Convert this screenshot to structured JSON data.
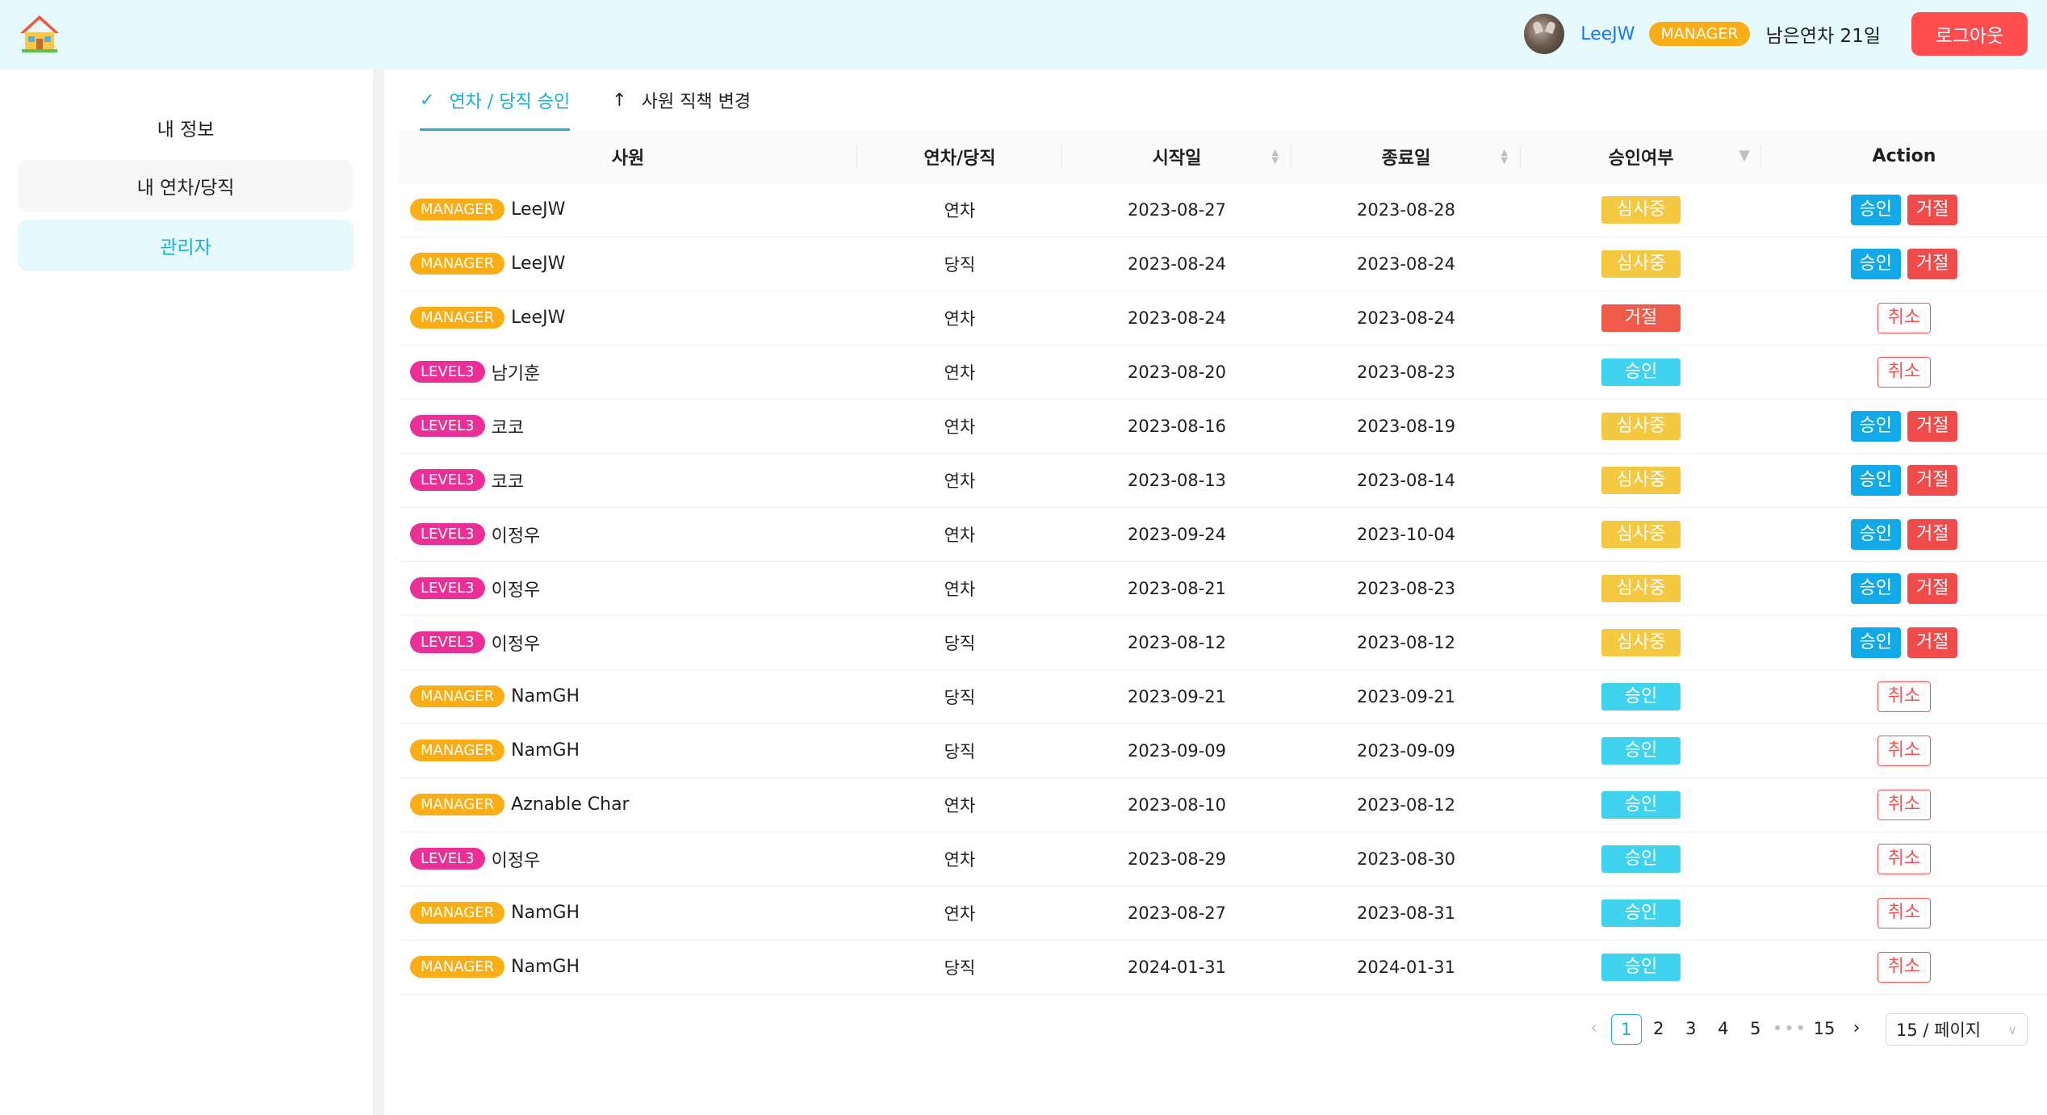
{
  "header": {
    "user_name": "LeeJW",
    "role": "MANAGER",
    "remaining_leave": "남은연차 21일",
    "logout_label": "로그아웃"
  },
  "sidebar": {
    "items": [
      {
        "label": "내 정보"
      },
      {
        "label": "내 연차/당직"
      },
      {
        "label": "관리자"
      }
    ]
  },
  "tabs": [
    {
      "label": "연차 / 당직 승인",
      "icon": "check-icon"
    },
    {
      "label": "사원 직책 변경",
      "icon": "arrow-up-icon"
    }
  ],
  "table": {
    "columns": [
      "사원",
      "연차/당직",
      "시작일",
      "종료일",
      "승인여부",
      "Action"
    ],
    "rows": [
      {
        "role": "MANAGER",
        "name": "LeeJW",
        "type": "연차",
        "start": "2023-08-27",
        "end": "2023-08-28",
        "status": "심사중",
        "actions": [
          "승인",
          "거절"
        ]
      },
      {
        "role": "MANAGER",
        "name": "LeeJW",
        "type": "당직",
        "start": "2023-08-24",
        "end": "2023-08-24",
        "status": "심사중",
        "actions": [
          "승인",
          "거절"
        ]
      },
      {
        "role": "MANAGER",
        "name": "LeeJW",
        "type": "연차",
        "start": "2023-08-24",
        "end": "2023-08-24",
        "status": "거절",
        "actions": [
          "취소"
        ]
      },
      {
        "role": "LEVEL3",
        "name": "남기훈",
        "type": "연차",
        "start": "2023-08-20",
        "end": "2023-08-23",
        "status": "승인",
        "actions": [
          "취소"
        ]
      },
      {
        "role": "LEVEL3",
        "name": "코코",
        "type": "연차",
        "start": "2023-08-16",
        "end": "2023-08-19",
        "status": "심사중",
        "actions": [
          "승인",
          "거절"
        ]
      },
      {
        "role": "LEVEL3",
        "name": "코코",
        "type": "연차",
        "start": "2023-08-13",
        "end": "2023-08-14",
        "status": "심사중",
        "actions": [
          "승인",
          "거절"
        ]
      },
      {
        "role": "LEVEL3",
        "name": "이정우",
        "type": "연차",
        "start": "2023-09-24",
        "end": "2023-10-04",
        "status": "심사중",
        "actions": [
          "승인",
          "거절"
        ]
      },
      {
        "role": "LEVEL3",
        "name": "이정우",
        "type": "연차",
        "start": "2023-08-21",
        "end": "2023-08-23",
        "status": "심사중",
        "actions": [
          "승인",
          "거절"
        ]
      },
      {
        "role": "LEVEL3",
        "name": "이정우",
        "type": "당직",
        "start": "2023-08-12",
        "end": "2023-08-12",
        "status": "심사중",
        "actions": [
          "승인",
          "거절"
        ]
      },
      {
        "role": "MANAGER",
        "name": "NamGH",
        "type": "당직",
        "start": "2023-09-21",
        "end": "2023-09-21",
        "status": "승인",
        "actions": [
          "취소"
        ]
      },
      {
        "role": "MANAGER",
        "name": "NamGH",
        "type": "당직",
        "start": "2023-09-09",
        "end": "2023-09-09",
        "status": "승인",
        "actions": [
          "취소"
        ]
      },
      {
        "role": "MANAGER",
        "name": "Aznable Char",
        "type": "연차",
        "start": "2023-08-10",
        "end": "2023-08-12",
        "status": "승인",
        "actions": [
          "취소"
        ]
      },
      {
        "role": "LEVEL3",
        "name": "이정우",
        "type": "연차",
        "start": "2023-08-29",
        "end": "2023-08-30",
        "status": "승인",
        "actions": [
          "취소"
        ]
      },
      {
        "role": "MANAGER",
        "name": "NamGH",
        "type": "연차",
        "start": "2023-08-27",
        "end": "2023-08-31",
        "status": "승인",
        "actions": [
          "취소"
        ]
      },
      {
        "role": "MANAGER",
        "name": "NamGH",
        "type": "당직",
        "start": "2024-01-31",
        "end": "2024-01-31",
        "status": "승인",
        "actions": [
          "취소"
        ]
      }
    ]
  },
  "pagination": {
    "pages": [
      "1",
      "2",
      "3",
      "4",
      "5",
      "•••",
      "15"
    ],
    "current": "1",
    "page_size": "15 / 페이지"
  },
  "colors": {
    "header_bg": "#e6f9fd",
    "accent": "#1ab0d6",
    "manager": "#faad14",
    "level3": "#eb2f96",
    "pending": "#f5c842",
    "approved": "#3fd3f0",
    "rejected": "#f05a4a",
    "logout": "#ff4d4f"
  }
}
